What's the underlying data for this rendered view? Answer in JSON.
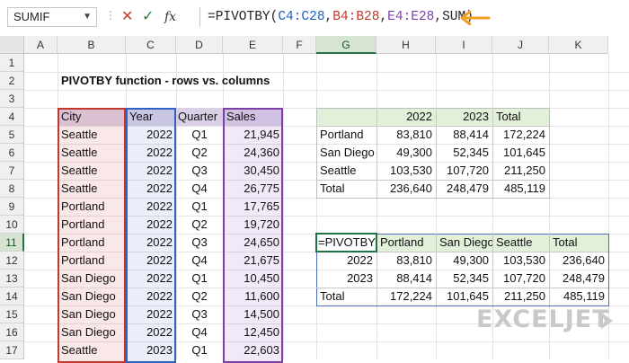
{
  "formula_bar": {
    "name_box": "SUMIF",
    "formula_prefix": "=PIVOTBY(",
    "ref1": "C4:C28",
    "ref2": "B4:B28",
    "ref3": "E4:E28",
    "formula_suffix": ",SUM)",
    "sep1": ",",
    "sep2": ","
  },
  "columns": [
    "A",
    "B",
    "C",
    "D",
    "E",
    "F",
    "G",
    "H",
    "I",
    "J",
    "K"
  ],
  "rows": [
    "1",
    "2",
    "3",
    "4",
    "5",
    "6",
    "7",
    "8",
    "9",
    "10",
    "11",
    "12",
    "13",
    "14",
    "15",
    "16",
    "17"
  ],
  "title": "PIVOTBY function - rows vs. columns",
  "source_table": {
    "headers": [
      "City",
      "Year",
      "Quarter",
      "Sales"
    ],
    "rows": [
      [
        "Seattle",
        "2022",
        "Q1",
        "21,945"
      ],
      [
        "Seattle",
        "2022",
        "Q2",
        "24,360"
      ],
      [
        "Seattle",
        "2022",
        "Q3",
        "30,450"
      ],
      [
        "Seattle",
        "2022",
        "Q4",
        "26,775"
      ],
      [
        "Portland",
        "2022",
        "Q1",
        "17,765"
      ],
      [
        "Portland",
        "2022",
        "Q2",
        "19,720"
      ],
      [
        "Portland",
        "2022",
        "Q3",
        "24,650"
      ],
      [
        "Portland",
        "2022",
        "Q4",
        "21,675"
      ],
      [
        "San Diego",
        "2022",
        "Q1",
        "10,450"
      ],
      [
        "San Diego",
        "2022",
        "Q2",
        "11,600"
      ],
      [
        "San Diego",
        "2022",
        "Q3",
        "14,500"
      ],
      [
        "San Diego",
        "2022",
        "Q4",
        "12,450"
      ],
      [
        "Seattle",
        "2023",
        "Q1",
        "22,603"
      ]
    ]
  },
  "pivot1": {
    "headers": [
      "",
      "2022",
      "2023",
      "Total"
    ],
    "rows": [
      [
        "Portland",
        "83,810",
        "88,414",
        "172,224"
      ],
      [
        "San Diego",
        "49,300",
        "52,345",
        "101,645"
      ],
      [
        "Seattle",
        "103,530",
        "107,720",
        "211,250"
      ],
      [
        "Total",
        "236,640",
        "248,479",
        "485,119"
      ]
    ]
  },
  "pivot2": {
    "headers": [
      "=PIVOTBY",
      "Portland",
      "San Diego",
      "Seattle",
      "Total"
    ],
    "rows": [
      [
        "2022",
        "83,810",
        "49,300",
        "103,530",
        "236,640"
      ],
      [
        "2023",
        "88,414",
        "52,345",
        "107,720",
        "248,479"
      ],
      [
        "Total",
        "172,224",
        "101,645",
        "211,250",
        "485,119"
      ]
    ]
  },
  "logo": "EXCELJET",
  "colors": {
    "accent": "#217346",
    "arrow": "#f0a020"
  }
}
